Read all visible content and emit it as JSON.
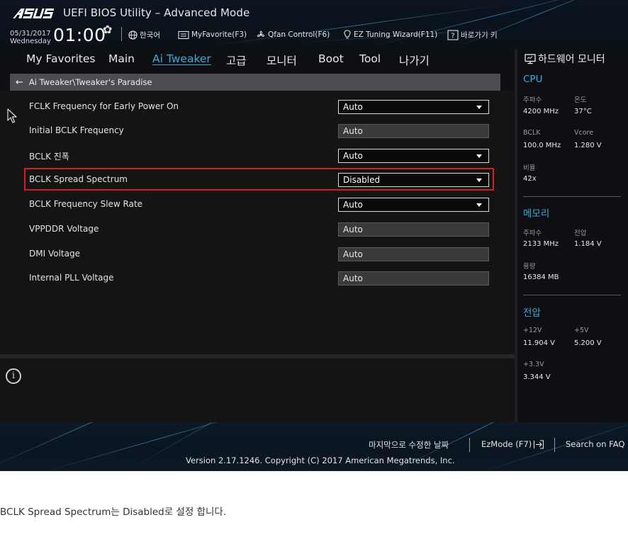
{
  "header": {
    "brand": "ASUS",
    "title": "UEFI BIOS Utility – Advanced Mode",
    "date": "05/31/2017",
    "day": "Wednesday",
    "time": "01:00",
    "language": "한국어",
    "myfavorite": "MyFavorite(F3)",
    "qfan": "Qfan Control(F6)",
    "ez_tuning": "EZ Tuning Wizard(F11)",
    "hotkeys": "바로가기 키"
  },
  "nav": {
    "tabs": [
      "My Favorites",
      "Main",
      "Ai Tweaker",
      "고급",
      "모니터",
      "Boot",
      "Tool",
      "나가기"
    ],
    "active": "Ai Tweaker"
  },
  "breadcrumb": "Ai Tweaker\\Tweaker's Paradise",
  "settings": [
    {
      "label": "FCLK Frequency for Early Power On",
      "value": "Auto",
      "type": "dropdown"
    },
    {
      "label": "Initial BCLK Frequency",
      "value": "Auto",
      "type": "readonly"
    },
    {
      "label": "BCLK 진폭",
      "value": "Auto",
      "type": "dropdown"
    },
    {
      "label": "BCLK Spread Spectrum",
      "value": "Disabled",
      "type": "dropdown",
      "highlighted": true
    },
    {
      "label": "BCLK Frequency Slew Rate",
      "value": "Auto",
      "type": "dropdown"
    },
    {
      "label": "VPPDDR Voltage",
      "value": "Auto",
      "type": "readonly"
    },
    {
      "label": "DMI Voltage",
      "value": "Auto",
      "type": "readonly"
    },
    {
      "label": "Internal PLL Voltage",
      "value": "Auto",
      "type": "readonly"
    }
  ],
  "hardware_monitor": {
    "title": "하드웨어 모니터",
    "cpu": {
      "title": "CPU",
      "freq_label": "주파수",
      "freq": "4200 MHz",
      "temp_label": "온도",
      "temp": "37°C",
      "bclk_label": "BCLK",
      "bclk": "100.0 MHz",
      "vcore_label": "Vcore",
      "vcore": "1.280 V",
      "ratio_label": "비율",
      "ratio": "42x"
    },
    "memory": {
      "title": "메모리",
      "freq_label": "주파수",
      "freq": "2133 MHz",
      "volt_label": "전압",
      "volt": "1.184 V",
      "cap_label": "용량",
      "cap": "16384 MB"
    },
    "voltage": {
      "title": "전압",
      "v12_label": "+12V",
      "v12": "11.904 V",
      "v5_label": "+5V",
      "v5": "5.200 V",
      "v33_label": "+3.3V",
      "v33": "3.344 V"
    }
  },
  "footer": {
    "last_modified": "마지막으로 수정한 날짜",
    "ezmode": "EzMode (F7)",
    "faq": "Search on FAQ",
    "version": "Version 2.17.1246. Copyright (C) 2017 American Megatrends, Inc."
  },
  "caption": "BCLK Spread Spectrum는 Disabled로 설정 합니다.",
  "colors": {
    "accent": "#3fa9d9",
    "highlight": "#d11f25",
    "background": "#141414"
  }
}
